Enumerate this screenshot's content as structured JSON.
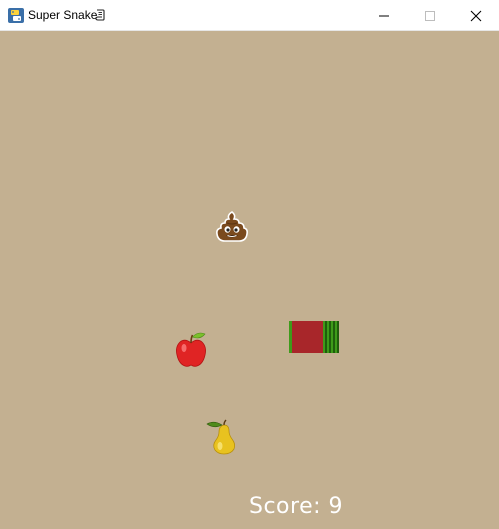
{
  "window": {
    "title": "Super Snake",
    "controls": {
      "minimize": "minimize-icon",
      "maximize": "maximize-icon",
      "close": "close-icon"
    }
  },
  "game": {
    "background_color": "#c3b091",
    "items": [
      {
        "name": "poop",
        "icon": "poop-emoji"
      },
      {
        "name": "apple",
        "icon": "red-apple"
      },
      {
        "name": "pear",
        "icon": "pear"
      }
    ],
    "snake": {
      "colors": {
        "body": "#a8262a",
        "stripe_green": "#3e9b1a",
        "stripe_dark": "#1f5e0c"
      }
    },
    "score_text": "Score: 9"
  }
}
